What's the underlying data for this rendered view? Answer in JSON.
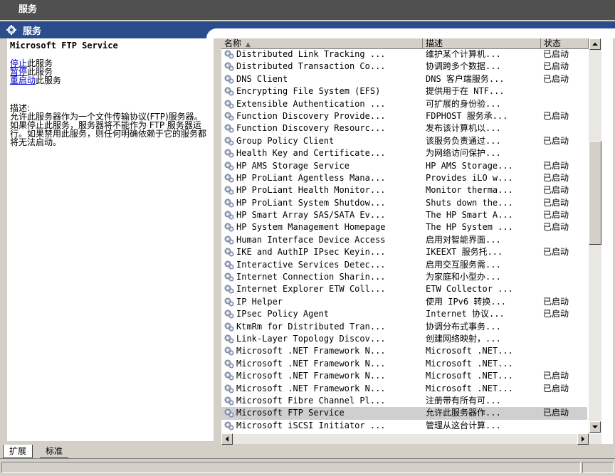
{
  "window": {
    "title": "服务"
  },
  "header": {
    "title": "服务",
    "icon": "gear-icon"
  },
  "left_pane": {
    "service_name": "Microsoft FTP Service",
    "links": [
      {
        "link": "停止",
        "suffix": "此服务"
      },
      {
        "link": "暂停",
        "suffix": "此服务"
      },
      {
        "link": "重启动",
        "suffix": "此服务"
      }
    ],
    "desc_label": "描述:",
    "desc_text": "允许此服务器作为一个文件传输协议(FTP)服务器。如果停止此服务，服务器将不能作为 FTP 服务器运行。如果禁用此服务，则任何明确依赖于它的服务都将无法启动。"
  },
  "columns": {
    "name": "名称",
    "description": "描述",
    "status": "状态"
  },
  "services": [
    {
      "name": "Distributed Link Tracking ...",
      "description": "维护某个计算机...",
      "status": "已启动"
    },
    {
      "name": "Distributed Transaction Co...",
      "description": "协调跨多个数据...",
      "status": "已启动"
    },
    {
      "name": "DNS Client",
      "description": "DNS 客户端服务...",
      "status": "已启动"
    },
    {
      "name": "Encrypting File System (EFS)",
      "description": "提供用于在 NTF...",
      "status": ""
    },
    {
      "name": "Extensible Authentication ...",
      "description": "可扩展的身份验...",
      "status": ""
    },
    {
      "name": "Function Discovery Provide...",
      "description": "FDPHOST 服务承...",
      "status": "已启动"
    },
    {
      "name": "Function Discovery Resourc...",
      "description": "发布该计算机以...",
      "status": ""
    },
    {
      "name": "Group Policy Client",
      "description": "该服务负责通过...",
      "status": "已启动"
    },
    {
      "name": "Health Key and Certificate...",
      "description": "为网络访问保护...",
      "status": ""
    },
    {
      "name": "HP AMS Storage Service",
      "description": "HP AMS Storage...",
      "status": "已启动"
    },
    {
      "name": "HP ProLiant Agentless Mana...",
      "description": "Provides iLO w...",
      "status": "已启动"
    },
    {
      "name": "HP ProLiant Health Monitor...",
      "description": "Monitor therma...",
      "status": "已启动"
    },
    {
      "name": "HP ProLiant System Shutdow...",
      "description": "Shuts down the...",
      "status": "已启动"
    },
    {
      "name": "HP Smart Array SAS/SATA Ev...",
      "description": "The HP Smart A...",
      "status": "已启动"
    },
    {
      "name": "HP System Management Homepage",
      "description": "The HP System ...",
      "status": "已启动"
    },
    {
      "name": "Human Interface Device Access",
      "description": "启用对智能界面...",
      "status": ""
    },
    {
      "name": "IKE and AuthIP IPsec Keyin...",
      "description": "IKEEXT 服务托...",
      "status": "已启动"
    },
    {
      "name": "Interactive Services Detec...",
      "description": "启用交互服务需...",
      "status": ""
    },
    {
      "name": "Internet Connection Sharin...",
      "description": "为家庭和小型办...",
      "status": ""
    },
    {
      "name": "Internet Explorer ETW Coll...",
      "description": "ETW Collector ...",
      "status": ""
    },
    {
      "name": "IP Helper",
      "description": "使用 IPv6 转换...",
      "status": "已启动"
    },
    {
      "name": "IPsec Policy Agent",
      "description": "Internet 协议...",
      "status": "已启动"
    },
    {
      "name": "KtmRm for Distributed Tran...",
      "description": "协调分布式事务...",
      "status": ""
    },
    {
      "name": "Link-Layer Topology Discov...",
      "description": "创建网络映射，...",
      "status": ""
    },
    {
      "name": "Microsoft .NET Framework N...",
      "description": "Microsoft .NET...",
      "status": ""
    },
    {
      "name": "Microsoft .NET Framework N...",
      "description": "Microsoft .NET...",
      "status": ""
    },
    {
      "name": "Microsoft .NET Framework N...",
      "description": "Microsoft .NET...",
      "status": "已启动"
    },
    {
      "name": "Microsoft .NET Framework N...",
      "description": "Microsoft .NET...",
      "status": "已启动"
    },
    {
      "name": "Microsoft Fibre Channel Pl...",
      "description": "注册带有所有可...",
      "status": ""
    },
    {
      "name": "Microsoft FTP Service",
      "description": "允许此服务器作...",
      "status": "已启动",
      "selected": true
    },
    {
      "name": "Microsoft iSCSI Initiator ...",
      "description": "管理从这台计算...",
      "status": ""
    }
  ],
  "tabs": [
    {
      "label": "扩展",
      "active": true
    },
    {
      "label": "标准",
      "active": false
    }
  ],
  "colors": {
    "titlebar": "#505050",
    "header": "#2b4d8b",
    "selection": "#cfcfcf",
    "link": "#0000cc"
  }
}
